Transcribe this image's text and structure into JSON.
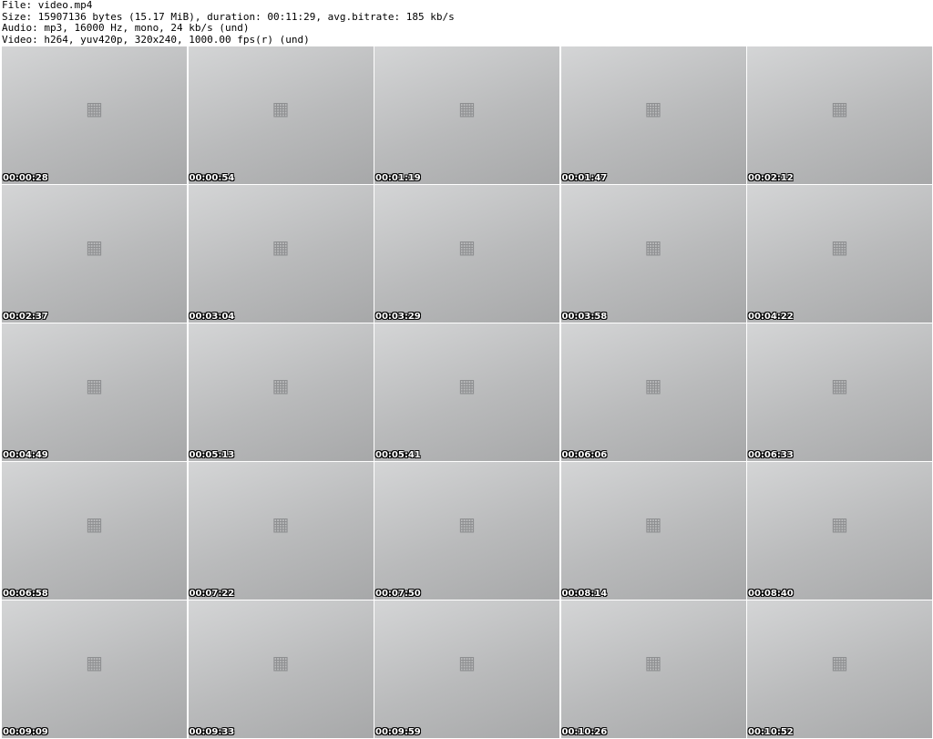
{
  "meta": {
    "file_line": "File: video.mp4",
    "size_line": "Size: 15907136 bytes (15.17 MiB), duration: 00:11:29, avg.bitrate: 185 kb/s",
    "audio_line": "Audio: mp3, 16000 Hz, mono, 24 kb/s (und)",
    "video_line": "Video: h264, yuv420p, 320x240, 1000.00 fps(r) (und)"
  },
  "frame_icon": "film-frame-icon",
  "timestamps": [
    "00:00:28",
    "00:00:54",
    "00:01:19",
    "00:01:47",
    "00:02:12",
    "00:02:37",
    "00:03:04",
    "00:03:29",
    "00:03:58",
    "00:04:22",
    "00:04:49",
    "00:05:13",
    "00:05:41",
    "00:06:06",
    "00:06:33",
    "00:06:58",
    "00:07:22",
    "00:07:50",
    "00:08:14",
    "00:08:40",
    "00:09:09",
    "00:09:33",
    "00:09:59",
    "00:10:26",
    "00:10:52"
  ]
}
